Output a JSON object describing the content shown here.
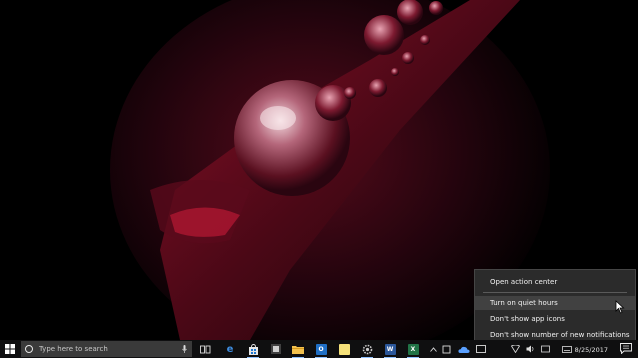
{
  "context_menu": {
    "items": [
      {
        "label": "Open action center"
      },
      {
        "label": "Turn on quiet hours"
      },
      {
        "label": "Don't show app icons"
      },
      {
        "label": "Don't show number of new notifications"
      }
    ]
  },
  "taskbar": {
    "search_placeholder": "Type here to search",
    "apps": [
      {
        "name": "task-view-icon",
        "letter": ""
      },
      {
        "name": "edge-icon",
        "letter": "e",
        "color": "#2d7cd6"
      },
      {
        "name": "store-icon",
        "letter": "",
        "color": "#e8e8e8"
      },
      {
        "name": "explorer-icon",
        "letter": "",
        "color": "#f2c14e"
      },
      {
        "name": "outlook-icon",
        "letter": "O",
        "color": "#1f6fc5"
      },
      {
        "name": "sticky-notes-icon",
        "letter": "",
        "color": "#f6e27a"
      },
      {
        "name": "settings-icon",
        "letter": "",
        "color": "#b5b5b5"
      },
      {
        "name": "word-icon",
        "letter": "W",
        "color": "#2b579a"
      },
      {
        "name": "excel-icon",
        "letter": "X",
        "color": "#217346"
      }
    ],
    "date": "8/25/2017"
  },
  "colors": {
    "menu_bg": "#2b2b2b",
    "menu_hover": "#414141",
    "taskbar_bg": "#0f0f10",
    "accent": "#8fc1ff"
  }
}
